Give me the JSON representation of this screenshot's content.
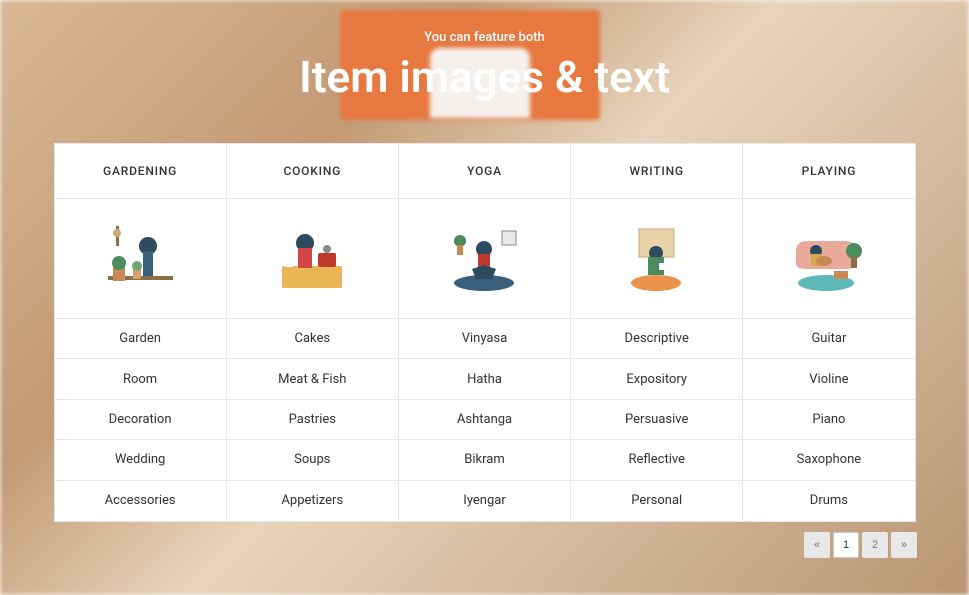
{
  "header": {
    "subtitle": "You can feature both",
    "title": "Item images & text"
  },
  "columns": [
    {
      "label": "GARDENING",
      "items": [
        "Garden",
        "Room",
        "Decoration",
        "Wedding",
        "Accessories"
      ]
    },
    {
      "label": "COOKING",
      "items": [
        "Cakes",
        "Meat & Fish",
        "Pastries",
        "Soups",
        "Appetizers"
      ]
    },
    {
      "label": "YOGA",
      "items": [
        "Vinyasa",
        "Hatha",
        "Ashtanga",
        "Bikram",
        "Iyengar"
      ]
    },
    {
      "label": "WRITING",
      "items": [
        "Descriptive",
        "Expository",
        "Persuasive",
        "Reflective",
        "Personal"
      ]
    },
    {
      "label": "PLAYING",
      "items": [
        "Guitar",
        "Violine",
        "Piano",
        "Saxophone",
        "Drums"
      ]
    }
  ],
  "pagination": {
    "prev_all": "«",
    "page1": "1",
    "page2": "2",
    "next_all": "»",
    "current": 1
  }
}
